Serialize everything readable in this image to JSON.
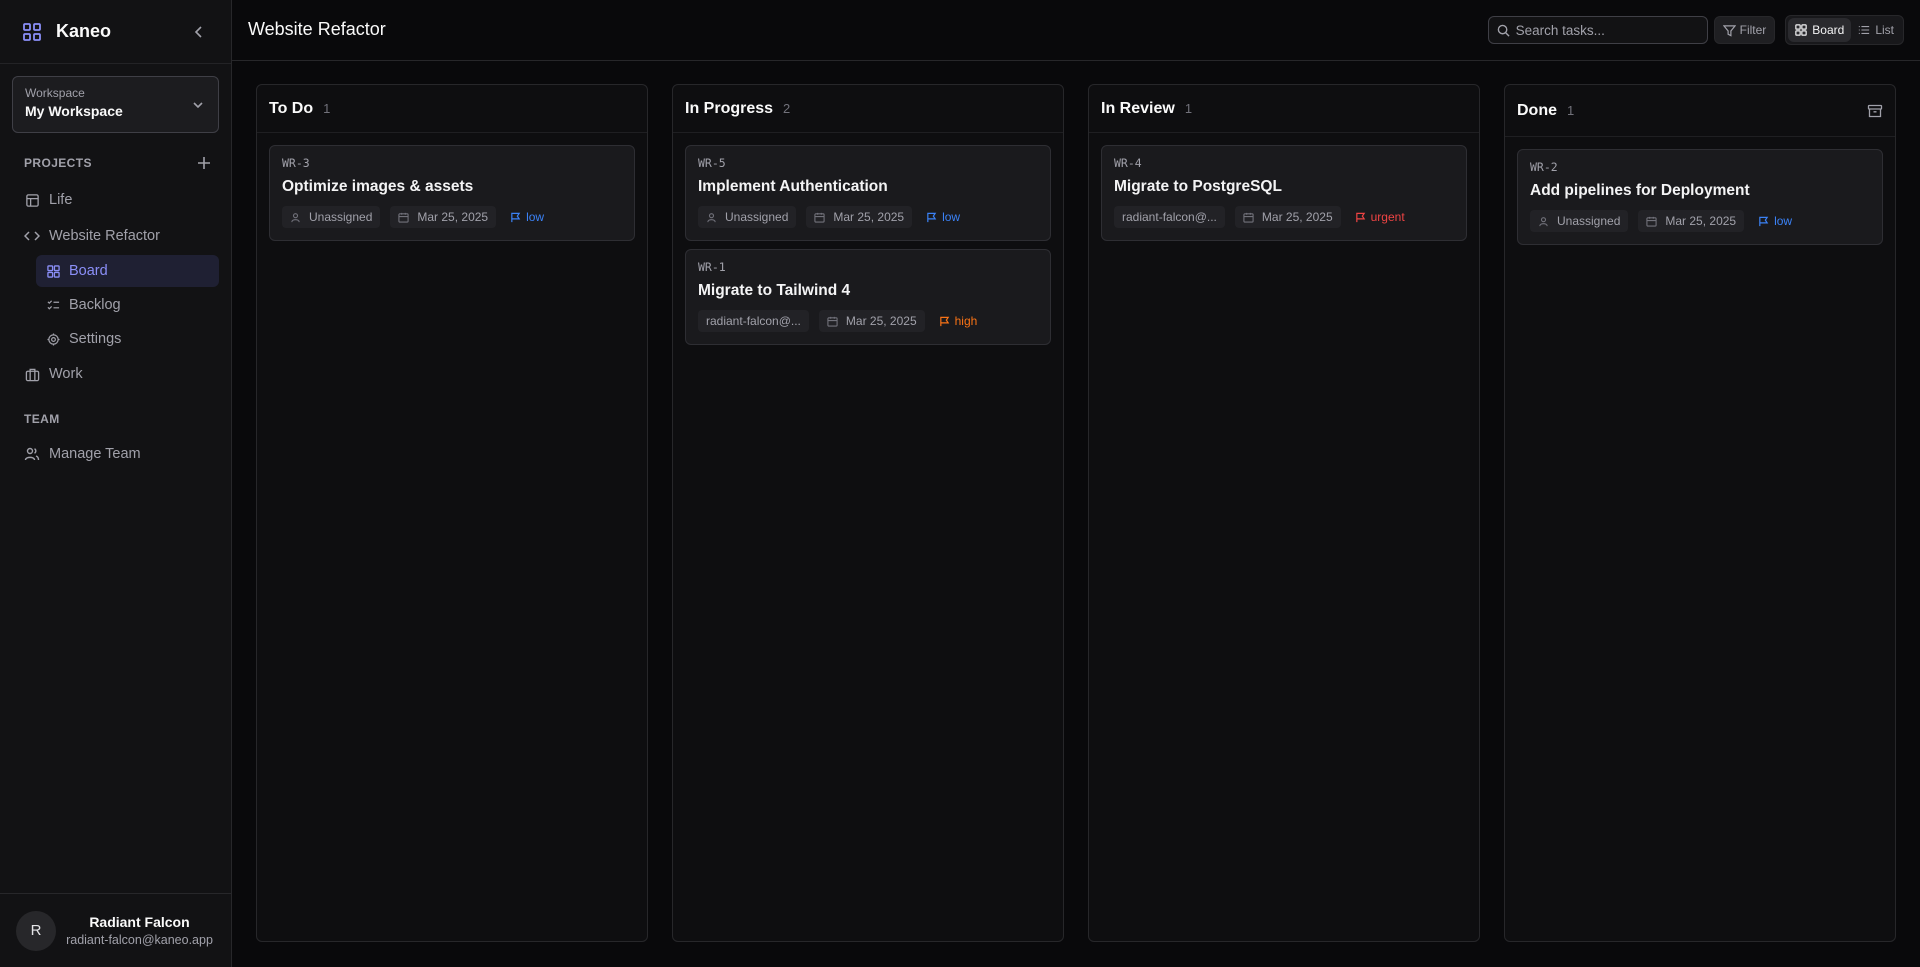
{
  "colors": {
    "accent": "#8b8ff8",
    "low": "#3b82f6",
    "high": "#f97316",
    "urgent": "#ef4444"
  },
  "sidebar": {
    "brand": "Kaneo",
    "workspace": {
      "label": "Workspace",
      "value": "My Workspace"
    },
    "projects_title": "PROJECTS",
    "projects": [
      {
        "label": "Life",
        "icon": "layout-icon"
      },
      {
        "label": "Website Refactor",
        "icon": "code-icon"
      }
    ],
    "subnav": [
      {
        "label": "Board",
        "icon": "grid-icon"
      },
      {
        "label": "Backlog",
        "icon": "list-checks-icon"
      },
      {
        "label": "Settings",
        "icon": "gear-icon"
      }
    ],
    "work": {
      "label": "Work",
      "icon": "briefcase-icon"
    },
    "team_title": "TEAM",
    "manage_team": "Manage Team",
    "user": {
      "initial": "R",
      "name": "Radiant Falcon",
      "email": "radiant-falcon@kaneo.app"
    }
  },
  "header": {
    "title": "Website Refactor",
    "search_placeholder": "Search tasks...",
    "filter_label": "Filter",
    "view_board": "Board",
    "view_list": "List"
  },
  "columns": [
    {
      "title": "To Do",
      "count": "1",
      "cards": [
        {
          "id": "WR-3",
          "title": "Optimize images & assets",
          "assignee": "Unassigned",
          "date": "Mar 25, 2025",
          "priority": "low"
        }
      ]
    },
    {
      "title": "In Progress",
      "count": "2",
      "cards": [
        {
          "id": "WR-5",
          "title": "Implement Authentication",
          "assignee": "Unassigned",
          "date": "Mar 25, 2025",
          "priority": "low"
        },
        {
          "id": "WR-1",
          "title": "Migrate to Tailwind 4",
          "assignee": "radiant-falcon@...",
          "date": "Mar 25, 2025",
          "priority": "high"
        }
      ]
    },
    {
      "title": "In Review",
      "count": "1",
      "cards": [
        {
          "id": "WR-4",
          "title": "Migrate to PostgreSQL",
          "assignee": "radiant-falcon@...",
          "date": "Mar 25, 2025",
          "priority": "urgent"
        }
      ]
    },
    {
      "title": "Done",
      "count": "1",
      "cards": [
        {
          "id": "WR-2",
          "title": "Add pipelines for Deployment",
          "assignee": "Unassigned",
          "date": "Mar 25, 2025",
          "priority": "low"
        }
      ]
    }
  ]
}
